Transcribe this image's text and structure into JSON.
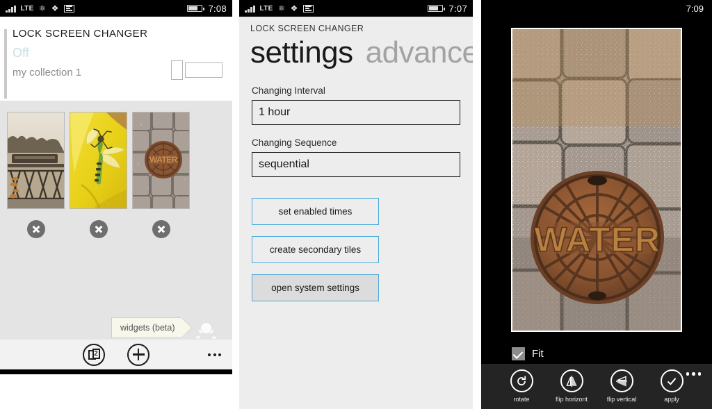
{
  "panel1": {
    "statusbar": {
      "network": "LTE",
      "time": "7:08",
      "icons": [
        "signal-bars-icon",
        "lte-label",
        "bluetooth-icon",
        "wifi-icon",
        "sim-card-icon",
        "battery-icon"
      ]
    },
    "app_title": "LOCK SCREEN CHANGER",
    "state": "Off",
    "collection": "my collection 1",
    "toggle": {
      "name": "enable-toggle",
      "value": "off"
    },
    "thumbnails": [
      {
        "alt": "train-on-bridge-photo",
        "delete_label": "remove"
      },
      {
        "alt": "dragonfly-on-yellow-flower-photo",
        "delete_label": "remove"
      },
      {
        "alt": "water-manhole-cover-photo",
        "delete_label": "remove"
      }
    ],
    "widgets_tag": "widgets (beta)",
    "widgets_icon": "sun-brightness-icon",
    "appbar": {
      "duplicate_icon": "duplicate-pages-icon",
      "duplicate_badge": "2",
      "add_icon": "plus-icon",
      "more_icon": "ellipsis-icon"
    }
  },
  "panel2": {
    "statusbar": {
      "network": "LTE",
      "time": "7:07"
    },
    "app_title": "LOCK SCREEN CHANGER",
    "pivot": {
      "active": "settings",
      "inactive": "advanced"
    },
    "fields": [
      {
        "label": "Changing Interval",
        "value": "1 hour"
      },
      {
        "label": "Changing Sequence",
        "value": "sequential"
      }
    ],
    "buttons": [
      {
        "label": "set enabled times",
        "pressed": false
      },
      {
        "label": "create secondary tiles",
        "pressed": false
      },
      {
        "label": "open system settings",
        "pressed": true
      }
    ],
    "accent_color": "#49a8d8"
  },
  "panel3": {
    "statusbar": {
      "time": "7:09"
    },
    "photo_alt": "water-manhole-cover-on-cobblestones",
    "fit": {
      "label": "Fit",
      "checked": true
    },
    "appbar": [
      {
        "label": "rotate",
        "icon": "rotate-icon"
      },
      {
        "label": "flip horizont",
        "icon": "flip-horizontal-icon"
      },
      {
        "label": "flip vertical",
        "icon": "flip-vertical-icon"
      },
      {
        "label": "apply",
        "icon": "check-icon"
      }
    ],
    "more_icon": "ellipsis-icon"
  }
}
